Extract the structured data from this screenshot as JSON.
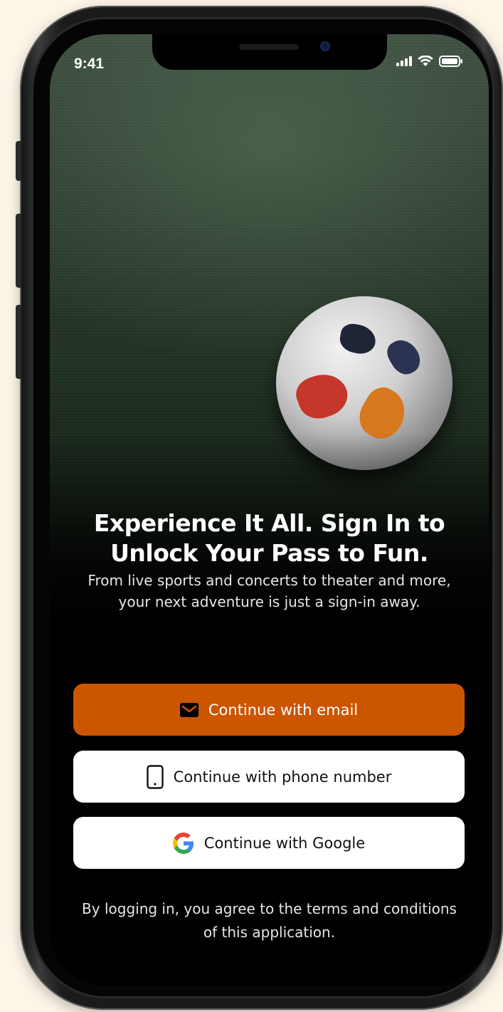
{
  "status_bar": {
    "time": "9:41"
  },
  "hero": {
    "headline": "Experience It All. Sign In to Unlock Your Pass to Fun.",
    "subtext": "From live sports and concerts to theater and more, your next adventure is just a sign-in away."
  },
  "buttons": {
    "email": {
      "label": "Continue with email",
      "icon": "mail-icon"
    },
    "phone": {
      "label": "Continue with phone number",
      "icon": "phone-icon"
    },
    "google": {
      "label": "Continue with Google",
      "icon": "google-icon"
    }
  },
  "terms": "By logging in, you agree to the terms and conditions of this application.",
  "colors": {
    "primary": "#cc5500",
    "background": "#000000",
    "page_background": "#fcf5e8",
    "button_light": "#ffffff",
    "google_blue": "#4285F4",
    "google_red": "#EA4335",
    "google_yellow": "#FBBC05",
    "google_green": "#34A853"
  }
}
